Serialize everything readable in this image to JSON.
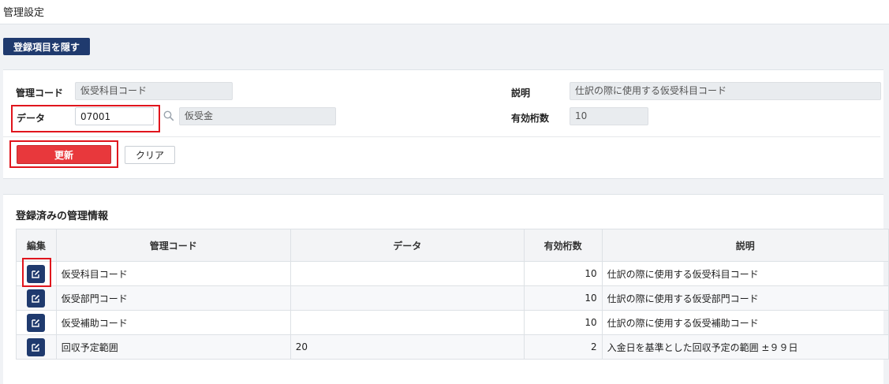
{
  "page": {
    "title": "管理設定"
  },
  "toolbar": {
    "toggle_label": "登録項目を隠す"
  },
  "form": {
    "code_label": "管理コード",
    "code_value": "仮受科目コード",
    "desc_label": "説明",
    "desc_value": "仕訳の際に使用する仮受科目コード",
    "data_label": "データ",
    "data_value": "07001",
    "data_name_value": "仮受金",
    "digits_label": "有効桁数",
    "digits_value": "10",
    "update_label": "更新",
    "clear_label": "クリア"
  },
  "list": {
    "title": "登録済みの管理情報",
    "headers": {
      "edit": "編集",
      "code": "管理コード",
      "data": "データ",
      "digits": "有効桁数",
      "desc": "説明"
    },
    "rows": [
      {
        "code": "仮受科目コード",
        "data": "",
        "digits": "10",
        "desc": "仕訳の際に使用する仮受科目コード"
      },
      {
        "code": "仮受部門コード",
        "data": "",
        "digits": "10",
        "desc": "仕訳の際に使用する仮受部門コード"
      },
      {
        "code": "仮受補助コード",
        "data": "",
        "digits": "10",
        "desc": "仕訳の際に使用する仮受補助コード"
      },
      {
        "code": "回収予定範囲",
        "data": "20",
        "digits": "2",
        "desc": "入金日を基準とした回収予定の範囲 ±９９日"
      }
    ]
  },
  "colors": {
    "navy": "#1f3a6e",
    "update": "#e8383c",
    "highlight": "#e0151d"
  },
  "icons": {
    "edit": "edit-icon",
    "search": "search-icon"
  }
}
